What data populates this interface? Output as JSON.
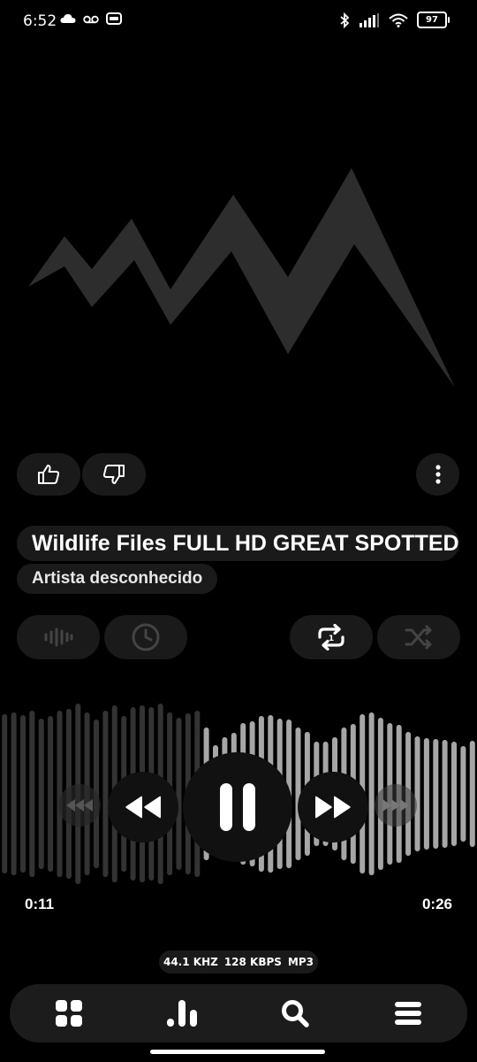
{
  "status_bar": {
    "time": "6:52",
    "battery": "97",
    "left_icons": [
      "cloud-icon",
      "voicemail-icon",
      "cast-icon"
    ],
    "right_icons": [
      "bluetooth-icon",
      "signal-icon",
      "wifi-icon",
      "battery-icon"
    ]
  },
  "track": {
    "title": "Wildlife Files FULL HD GREAT SPOTTED",
    "artist": "Artista desconhecido"
  },
  "actions": {
    "like_icon": "thumbs-up-icon",
    "dislike_icon": "thumbs-down-icon",
    "more_icon": "more-vertical-icon"
  },
  "toggles": {
    "equalizer_icon": "waveform-icon",
    "sleep_timer_icon": "clock-icon",
    "repeat_icon": "repeat-one-icon",
    "shuffle_icon": "shuffle-icon"
  },
  "playback": {
    "elapsed": "0:11",
    "duration": "0:26",
    "progress": 0.42,
    "state": "playing"
  },
  "audio_format": {
    "sample_rate": "44.1 KHZ",
    "bitrate": "128 KBPS",
    "codec": "MP3"
  },
  "bottom_nav": [
    "grid-icon",
    "bar-chart-icon",
    "search-icon",
    "menu-icon"
  ],
  "colors": {
    "background": "#000000",
    "surface": "#1a1a1a",
    "art": "#2d2d2d",
    "wave_played": "#333333",
    "wave_unplayed": "#a6a6a6"
  }
}
